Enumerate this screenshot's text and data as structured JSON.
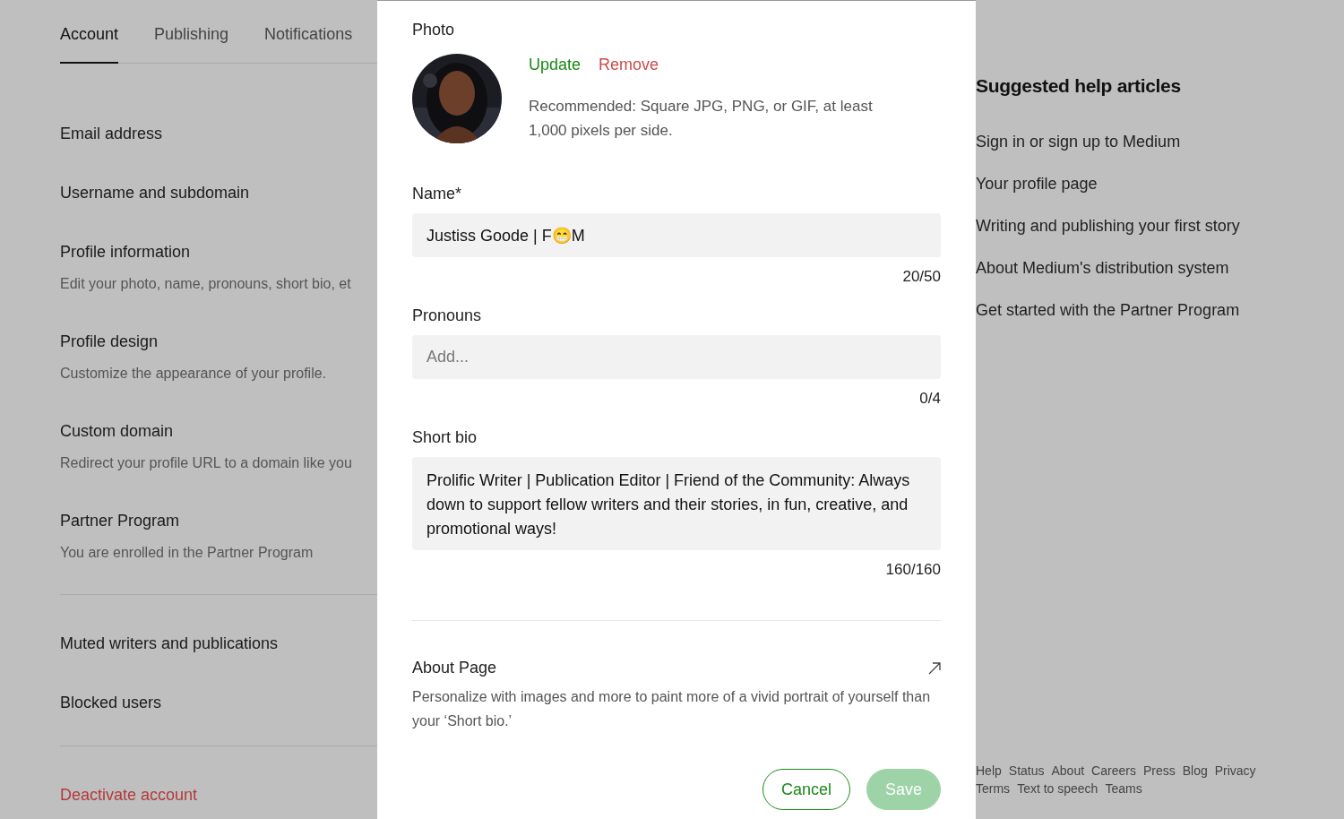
{
  "tabs": [
    {
      "label": "Account",
      "selected": true
    },
    {
      "label": "Publishing",
      "selected": false
    },
    {
      "label": "Notifications",
      "selected": false
    }
  ],
  "settings_groups": [
    {
      "items": [
        {
          "kind": "setting",
          "title": "Email address"
        },
        {
          "kind": "setting",
          "title": "Username and subdomain"
        },
        {
          "kind": "setting",
          "title": "Profile information",
          "description": "Edit your photo, name, pronouns, short bio, et"
        },
        {
          "kind": "setting",
          "title": "Profile design",
          "description": "Customize the appearance of your profile."
        },
        {
          "kind": "setting",
          "title": "Custom domain",
          "description": "Redirect your profile URL to a domain like you"
        },
        {
          "kind": "setting",
          "title": "Partner Program",
          "description": "You are enrolled in the Partner Program"
        }
      ]
    },
    {
      "items": [
        {
          "kind": "setting",
          "title": "Muted writers and publications"
        },
        {
          "kind": "setting",
          "title": "Blocked users"
        }
      ]
    },
    {
      "items": [
        {
          "kind": "danger",
          "title": "Deactivate account"
        }
      ]
    }
  ],
  "dialog": {
    "photo": {
      "label": "Photo",
      "update": "Update",
      "remove": "Remove",
      "hint": "Recommended: Square JPG, PNG, or GIF, at least 1,000 pixels per side."
    },
    "fields": [
      {
        "kind": "input",
        "label": "Name*",
        "value": "Justiss Goode | F😁M",
        "counter": "20/50"
      },
      {
        "kind": "input",
        "label": "Pronouns",
        "placeholder": "Add...",
        "counter": "0/4"
      },
      {
        "kind": "textarea",
        "label": "Short bio",
        "value": "Prolific Writer | Publication Editor | Friend of the Community: Always down to support fellow writers and their stories, in fun, creative, and promotional ways!",
        "counter": "160/160"
      }
    ],
    "about": {
      "title": "About Page",
      "description": "Personalize with images and more to paint more of a vivid portrait of yourself than your ‘Short bio.’"
    },
    "buttons": [
      {
        "kind": "secondary",
        "label": "Cancel",
        "disabled": false
      },
      {
        "kind": "primary",
        "label": "Save",
        "disabled": true
      }
    ]
  },
  "help": {
    "title": "Suggested help articles",
    "articles": [
      "Sign in or sign up to Medium",
      "Your profile page",
      "Writing and publishing your first story",
      "About Medium's distribution system",
      "Get started with the Partner Program"
    ]
  },
  "footer_links": [
    [
      "Help",
      "Status",
      "About",
      "Careers",
      "Press",
      "Blog",
      "Privacy"
    ],
    [
      "Terms",
      "Text to speech",
      "Teams"
    ]
  ]
}
